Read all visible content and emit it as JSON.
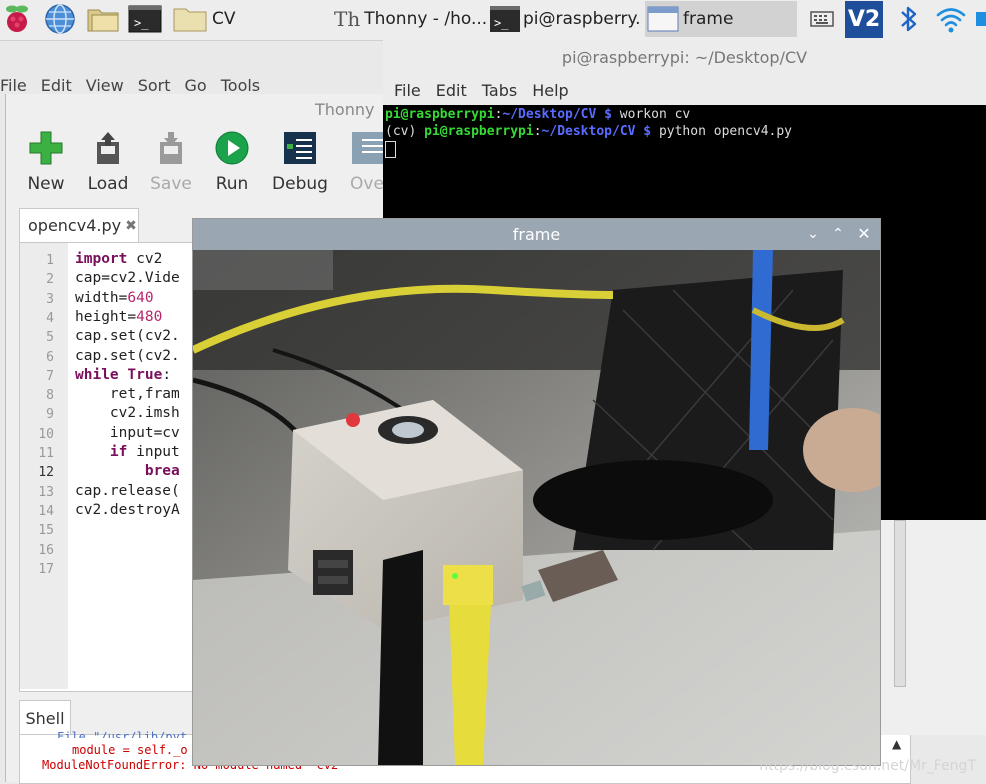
{
  "taskbar": {
    "tasks": [
      {
        "label": "CV",
        "icon": "folder-icon"
      },
      {
        "label": "Thonny  -  /ho...",
        "icon": "thonny-icon"
      },
      {
        "label": "pi@raspberry...",
        "icon": "terminal-icon"
      },
      {
        "label": "frame",
        "icon": "window-icon"
      }
    ],
    "tray_vnc_label": "V2"
  },
  "thonny": {
    "menu": [
      "File",
      "Edit",
      "View",
      "Sort",
      "Go",
      "Tools"
    ],
    "title": "Thonny",
    "toolbar": {
      "new": "New",
      "load": "Load",
      "save": "Save",
      "run": "Run",
      "debug": "Debug",
      "over": "Over"
    },
    "editor_tab": "opencv4.py",
    "line_numbers": [
      "1",
      "2",
      "3",
      "4",
      "5",
      "6",
      "7",
      "8",
      "9",
      "10",
      "11",
      "12",
      "13",
      "14",
      "15",
      "16",
      "17"
    ],
    "shell_tab": "Shell",
    "shell_lines": [
      "File \"/usr/lib/pyt",
      "module = self._o",
      "ModuleNotFoundError: No module named 'cv2'"
    ]
  },
  "code": {
    "l1_kw": "import",
    "l1_rest": " cv2",
    "l2": "cap=cv2.Vide",
    "l3_a": "width=",
    "l3_n": "640",
    "l4_a": "height=",
    "l4_n": "480",
    "l5": "cap.set(cv2.",
    "l6": "cap.set(cv2.",
    "l7_kw": "while",
    "l7_kw2": "True",
    "l7_rest": ":",
    "l8": "    ret,fram",
    "l9": "    cv2.imsh",
    "l10": "    input=cv",
    "l11_kw": "if",
    "l11_rest": " input",
    "l12_kw": "brea",
    "l13": "cap.release(",
    "l14": "cv2.destroyA"
  },
  "terminal": {
    "title": "pi@raspberrypi: ~/Desktop/CV",
    "menu": [
      "File",
      "Edit",
      "Tabs",
      "Help"
    ],
    "line1": {
      "user": "pi@raspberrypi",
      "sep": ":",
      "path": "~/Desktop/CV $",
      "cmd": " workon cv"
    },
    "line2": {
      "prefix": "(cv) ",
      "user": "pi@raspberrypi",
      "sep": ":",
      "path": "~/Desktop/CV $",
      "cmd": " python opencv4.py"
    }
  },
  "frame_window": {
    "title": "frame"
  },
  "watermark": "https://blog.csdn.net/Mr_FengT",
  "colors": {
    "run_green": "#1aa34a",
    "new_green": "#3cb043",
    "frame_titlebar": "#9aa6b2",
    "prompt_green": "#36d936",
    "prompt_blue": "#5a6cff"
  }
}
